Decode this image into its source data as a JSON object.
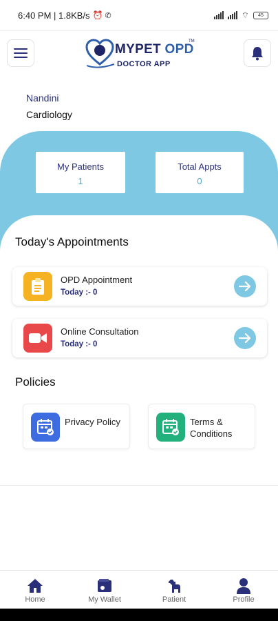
{
  "status_bar": {
    "time": "6:40 PM",
    "speed": "1.8KB/s",
    "battery": "45"
  },
  "header": {
    "logo_title_a": "MYPET ",
    "logo_title_b": "OPD",
    "logo_tm": "TM",
    "logo_subtitle": "DOCTOR APP"
  },
  "user": {
    "name": "Nandini",
    "department": "Cardiology"
  },
  "stats": [
    {
      "label": "My Patients",
      "value": "1"
    },
    {
      "label": "Total Appts",
      "value": "0"
    }
  ],
  "appointments": {
    "title": "Today's Appointments",
    "items": [
      {
        "title": "OPD Appointment",
        "subtitle": "Today :- 0",
        "icon": "clipboard-icon",
        "color": "#f5b323"
      },
      {
        "title": "Online Consultation",
        "subtitle": "Today :- 0",
        "icon": "video-camera-icon",
        "color": "#e8484a"
      }
    ]
  },
  "policies": {
    "title": "Policies",
    "items": [
      {
        "label": "Privacy Policy",
        "icon": "calendar-document-icon",
        "color": "#3d6ce0"
      },
      {
        "label": "Terms & Conditions",
        "icon": "calendar-document-icon",
        "color": "#22b07d"
      }
    ]
  },
  "bottom_nav": [
    {
      "label": "Home",
      "icon": "home-icon"
    },
    {
      "label": "My Wallet",
      "icon": "wallet-icon"
    },
    {
      "label": "Patient",
      "icon": "dog-icon"
    },
    {
      "label": "Profile",
      "icon": "person-icon"
    }
  ],
  "colors": {
    "accent_blue": "#7ec8e3",
    "brand_navy": "#1e2566",
    "text_navy": "#2a2f7a"
  }
}
